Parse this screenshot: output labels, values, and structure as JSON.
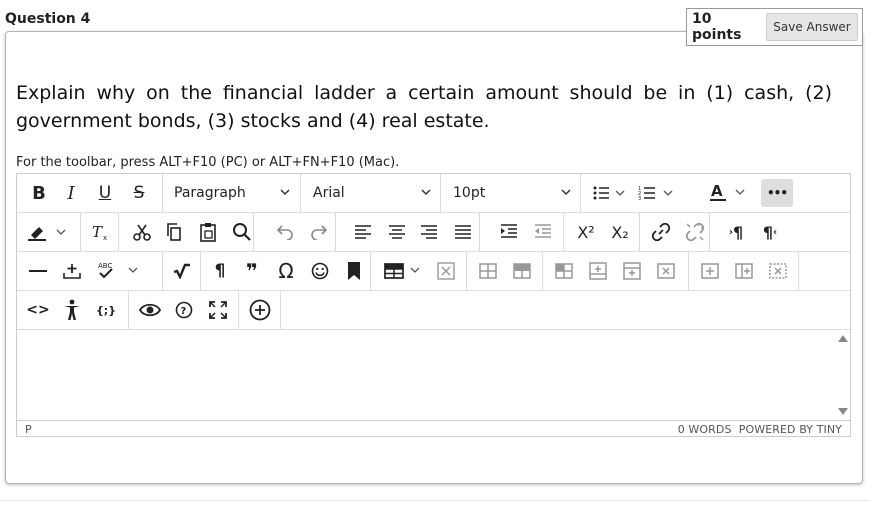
{
  "question": {
    "title": "Question 4",
    "points": "10 points",
    "save_label": "Save Answer",
    "text": "Explain why on the financial ladder a certain amount should be in (1) cash, (2) government bonds, (3) stocks and (4) real estate."
  },
  "editor": {
    "toolbar_hint": "For the toolbar, press ALT+F10 (PC) or ALT+FN+F10 (Mac).",
    "block_format": "Paragraph",
    "font_family": "Arial",
    "font_size": "10pt",
    "status_path": "P",
    "word_count": "0 WORDS",
    "powered_by": "POWERED BY TINY",
    "glyphs": {
      "bold": "B",
      "italic": "I",
      "underline": "U",
      "strike": "S",
      "font_color": "A",
      "more": "•••",
      "superscript": "X²",
      "subscript": "X₂",
      "ltr": "¶",
      "rtl": "¶",
      "pilcrow": "¶",
      "quote": "❞",
      "omega": "Ω",
      "abc": "ABC",
      "code": "<>",
      "braces": "{;}"
    }
  },
  "colors": {
    "accent_more_bg": "#dedede",
    "border": "#cccccc",
    "text": "#222222"
  }
}
